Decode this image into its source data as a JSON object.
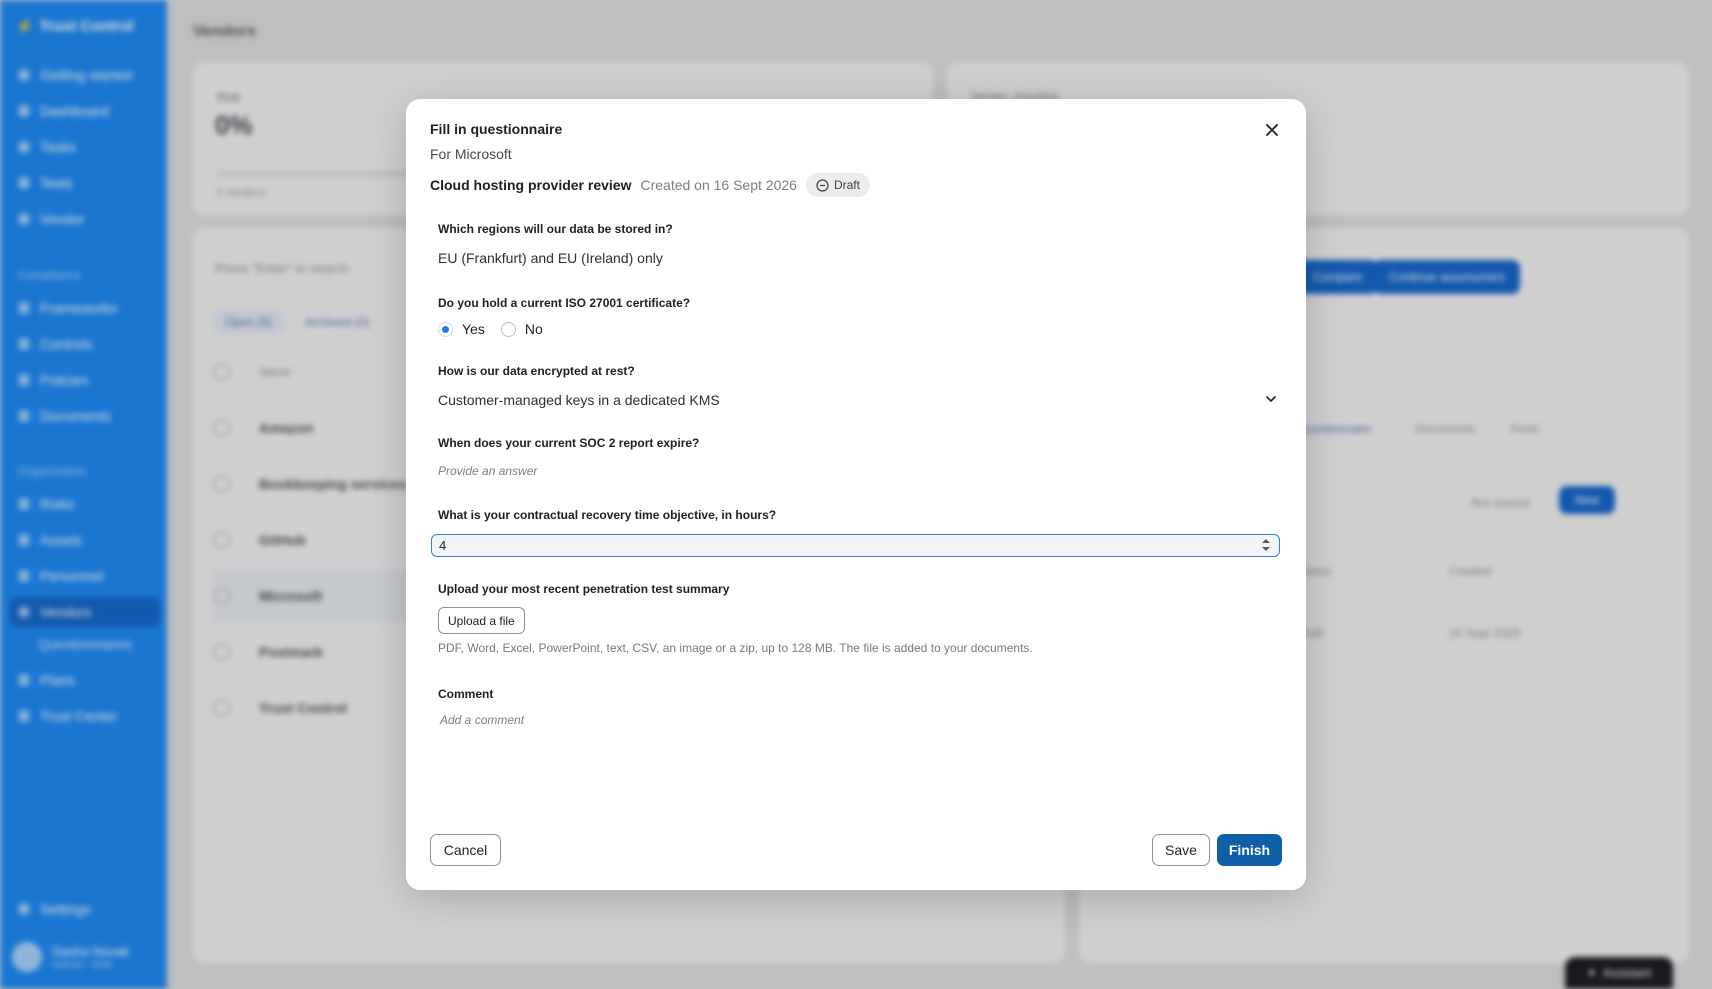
{
  "background": {
    "brand": "Trust Control",
    "nav": [
      {
        "label": "Getting started"
      },
      {
        "label": "Dashboard"
      },
      {
        "label": "Tasks"
      },
      {
        "label": "Tests"
      },
      {
        "label": "Vendor"
      }
    ],
    "compliance_section": "Compliance",
    "compliance_nav": [
      {
        "label": "Frameworks"
      },
      {
        "label": "Controls"
      },
      {
        "label": "Policies"
      },
      {
        "label": "Documents"
      }
    ],
    "organization_section": "Organization",
    "organization_nav": [
      {
        "label": "Risks"
      },
      {
        "label": "Assets"
      },
      {
        "label": "Personnel"
      },
      {
        "label": "Vendors"
      },
      {
        "label": "Questionnaires"
      },
      {
        "label": "Plans"
      },
      {
        "label": "Trust Center"
      }
    ],
    "settings": "Settings",
    "user_name": "Sasha Novak",
    "user_role": "Admin · Edit",
    "page_title": "Vendors",
    "kpi_label": "Risk",
    "kpi_value": "0%",
    "kpi_sub": "5 vendors",
    "card2_title": "Vendor checklist",
    "search_placeholder": "Press \"Enter\" to search",
    "chip_open": "Open (5)",
    "chip_archived": "Archived (0)",
    "col_name": "Name",
    "vendors": [
      "Amazon",
      "Bookkeeping services",
      "GitHub",
      "Microsoft",
      "Postmark",
      "Trust Control"
    ],
    "btn_compare": "Compare",
    "btn_continue": "Continue assessment",
    "tabs": [
      "Questionnaire",
      "Documents",
      "Feed"
    ],
    "chip_not_started": "Not started",
    "chip_new": "New",
    "col_status": "Status",
    "col_created": "Created",
    "row_status": "Draft",
    "row_created": "16 Sept 2026",
    "assistant": "Assistant"
  },
  "modal": {
    "title": "Fill in questionnaire",
    "subtitle": "For Microsoft",
    "questionnaire_name": "Cloud hosting provider review",
    "created": "Created on 16 Sept 2026",
    "status_badge": "Draft",
    "questions": [
      {
        "label": "Which regions will our data be stored in?",
        "answer": "EU (Frankfurt) and EU (Ireland) only"
      },
      {
        "label": "Do you hold a current ISO 27001 certificate?",
        "options": [
          "Yes",
          "No"
        ],
        "selected": "Yes"
      },
      {
        "label": "How is our data encrypted at rest?",
        "selected_option": "Customer-managed keys in a dedicated KMS"
      },
      {
        "label": "When does your current SOC 2 report expire?",
        "placeholder": "Provide an answer"
      },
      {
        "label": "What is your contractual recovery time objective, in hours?",
        "value": "4"
      },
      {
        "label": "Upload your most recent penetration test summary",
        "button": "Upload a file",
        "help": "PDF, Word, Excel, PowerPoint, text, CSV, an image or a zip, up to 128 MB. The file is added to your documents."
      },
      {
        "label": "Comment",
        "placeholder": "Add a comment"
      }
    ],
    "cancel": "Cancel",
    "save": "Save",
    "finish": "Finish"
  },
  "colors": {
    "sidebar": "#1f87ef",
    "primary_button": "#0f5fa8",
    "radio_selected": "#1f7de6",
    "focus_border": "#2f7fd9"
  }
}
